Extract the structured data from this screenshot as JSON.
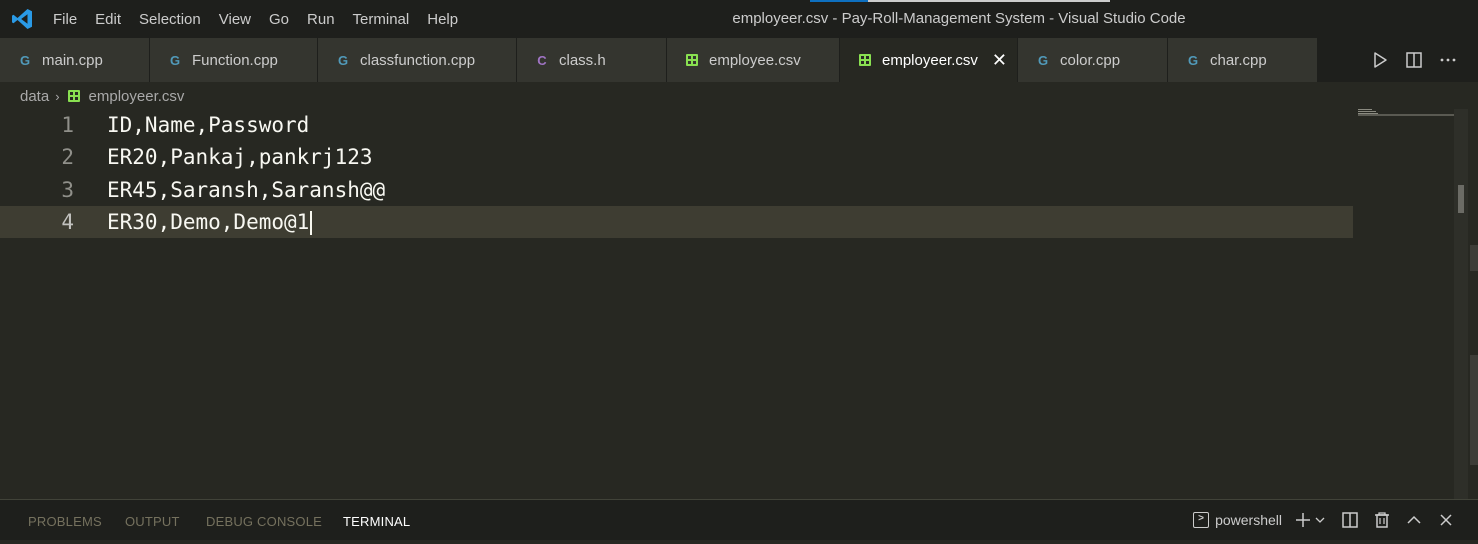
{
  "titlebar": {
    "menu": [
      "File",
      "Edit",
      "Selection",
      "View",
      "Go",
      "Run",
      "Terminal",
      "Help"
    ],
    "window_title": "employeer.csv - Pay-Roll-Management System - Visual Studio Code"
  },
  "tabs": [
    {
      "label": "main.cpp",
      "icon": "cpp-icon"
    },
    {
      "label": "Function.cpp",
      "icon": "cpp-icon"
    },
    {
      "label": "classfunction.cpp",
      "icon": "cpp-icon"
    },
    {
      "label": "class.h",
      "icon": "c-header-icon"
    },
    {
      "label": "employee.csv",
      "icon": "csv-icon"
    },
    {
      "label": "employeer.csv",
      "icon": "csv-icon",
      "active": true
    },
    {
      "label": "color.cpp",
      "icon": "cpp-icon"
    },
    {
      "label": "char.cpp",
      "icon": "cpp-icon"
    }
  ],
  "tab_glyphs": {
    "cpp": "G",
    "h": "C",
    "close": "✕"
  },
  "breadcrumb": {
    "folder": "data",
    "separator": "›",
    "file": "employeer.csv"
  },
  "editor": {
    "lines": [
      {
        "number": "1",
        "text": "ID,Name,Password"
      },
      {
        "number": "2",
        "text": "ER20,Pankaj,pankrj123"
      },
      {
        "number": "3",
        "text": "ER45,Saransh,Saransh@@"
      },
      {
        "number": "4",
        "text": "ER30,Demo,Demo@1"
      }
    ],
    "current_line": 4
  },
  "panel": {
    "tabs": [
      "PROBLEMS",
      "OUTPUT",
      "DEBUG CONSOLE",
      "TERMINAL"
    ],
    "active_tab": "TERMINAL",
    "terminal_name": "powershell"
  },
  "colors": {
    "editor_bg": "#272822",
    "titlebar_bg": "#1e1f1c",
    "accent": "#0e70c0",
    "csv_icon": "#89e051",
    "cpp_icon": "#519aba"
  }
}
